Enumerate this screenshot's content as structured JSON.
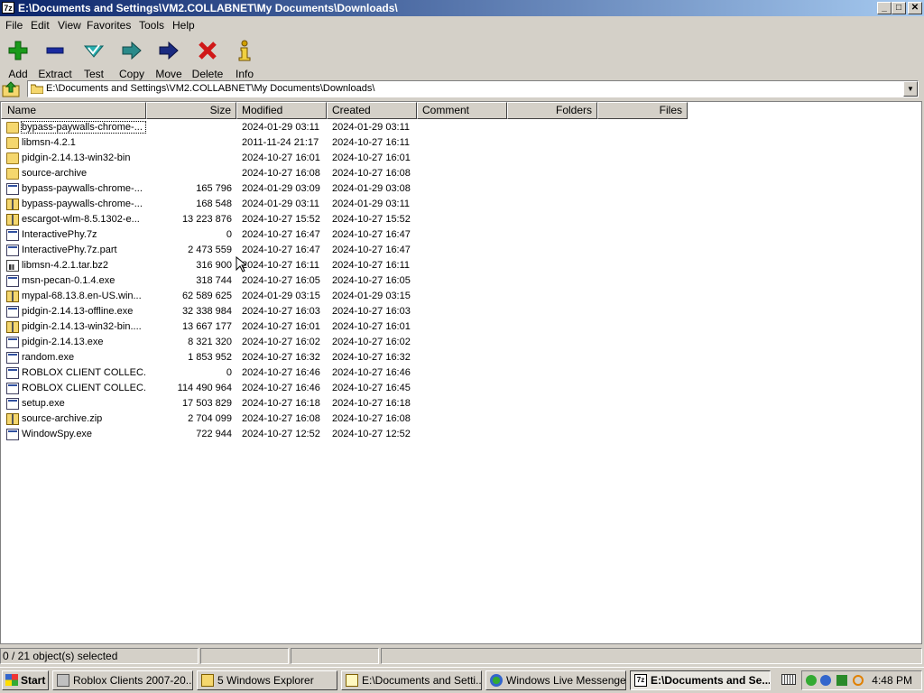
{
  "window": {
    "title_icon": "7z",
    "title": "E:\\Documents and Settings\\VM2.COLLABNET\\My Documents\\Downloads\\",
    "controls": {
      "minimize": "_",
      "maximize": "□",
      "close": "✕"
    }
  },
  "menu": [
    "File",
    "Edit",
    "View",
    "Favorites",
    "Tools",
    "Help"
  ],
  "toolbar": [
    {
      "label": "Add",
      "icon": "plus-icon",
      "color": "#1a9a1a"
    },
    {
      "label": "Extract",
      "icon": "minus-icon",
      "color": "#1a2aa0"
    },
    {
      "label": "Test",
      "icon": "check-icon",
      "color": "#2aa0a0"
    },
    {
      "label": "Copy",
      "icon": "copy-arrow-icon",
      "color": "#2a8a8a"
    },
    {
      "label": "Move",
      "icon": "move-arrow-icon",
      "color": "#1a2a80"
    },
    {
      "label": "Delete",
      "icon": "delete-x-icon",
      "color": "#d01818"
    },
    {
      "label": "Info",
      "icon": "info-icon",
      "color": "#b08000"
    }
  ],
  "address": {
    "value": "E:\\Documents and Settings\\VM2.COLLABNET\\My Documents\\Downloads\\"
  },
  "columns": [
    "Name",
    "Size",
    "Modified",
    "Created",
    "Comment",
    "Folders",
    "Files"
  ],
  "files": [
    {
      "name": "bypass-paywalls-chrome-...",
      "size": "",
      "modified": "2024-01-29 03:11",
      "created": "2024-01-29 03:11",
      "type": "folder"
    },
    {
      "name": "libmsn-4.2.1",
      "size": "",
      "modified": "2011-11-24 21:17",
      "created": "2024-10-27 16:11",
      "type": "folder"
    },
    {
      "name": "pidgin-2.14.13-win32-bin",
      "size": "",
      "modified": "2024-10-27 16:01",
      "created": "2024-10-27 16:01",
      "type": "folder"
    },
    {
      "name": "source-archive",
      "size": "",
      "modified": "2024-10-27 16:08",
      "created": "2024-10-27 16:08",
      "type": "folder"
    },
    {
      "name": "bypass-paywalls-chrome-...",
      "size": "165 796",
      "modified": "2024-01-29 03:09",
      "created": "2024-01-29 03:08",
      "type": "file"
    },
    {
      "name": "bypass-paywalls-chrome-...",
      "size": "168 548",
      "modified": "2024-01-29 03:11",
      "created": "2024-01-29 03:11",
      "type": "zip"
    },
    {
      "name": "escargot-wlm-8.5.1302-e...",
      "size": "13 223 876",
      "modified": "2024-10-27 15:52",
      "created": "2024-10-27 15:52",
      "type": "zip"
    },
    {
      "name": "InteractivePhy.7z",
      "size": "0",
      "modified": "2024-10-27 16:47",
      "created": "2024-10-27 16:47",
      "type": "file"
    },
    {
      "name": "InteractivePhy.7z.part",
      "size": "2 473 559",
      "modified": "2024-10-27 16:47",
      "created": "2024-10-27 16:47",
      "type": "file"
    },
    {
      "name": "libmsn-4.2.1.tar.bz2",
      "size": "316 900",
      "modified": "2024-10-27 16:11",
      "created": "2024-10-27 16:11",
      "type": "img"
    },
    {
      "name": "msn-pecan-0.1.4.exe",
      "size": "318 744",
      "modified": "2024-10-27 16:05",
      "created": "2024-10-27 16:05",
      "type": "file"
    },
    {
      "name": "mypal-68.13.8.en-US.win...",
      "size": "62 589 625",
      "modified": "2024-01-29 03:15",
      "created": "2024-01-29 03:15",
      "type": "zip"
    },
    {
      "name": "pidgin-2.14.13-offline.exe",
      "size": "32 338 984",
      "modified": "2024-10-27 16:03",
      "created": "2024-10-27 16:03",
      "type": "file"
    },
    {
      "name": "pidgin-2.14.13-win32-bin....",
      "size": "13 667 177",
      "modified": "2024-10-27 16:01",
      "created": "2024-10-27 16:01",
      "type": "zip"
    },
    {
      "name": "pidgin-2.14.13.exe",
      "size": "8 321 320",
      "modified": "2024-10-27 16:02",
      "created": "2024-10-27 16:02",
      "type": "file"
    },
    {
      "name": "random.exe",
      "size": "1 853 952",
      "modified": "2024-10-27 16:32",
      "created": "2024-10-27 16:32",
      "type": "file"
    },
    {
      "name": "ROBLOX CLIENT COLLEC...",
      "size": "0",
      "modified": "2024-10-27 16:46",
      "created": "2024-10-27 16:46",
      "type": "file"
    },
    {
      "name": "ROBLOX CLIENT COLLEC...",
      "size": "114 490 964",
      "modified": "2024-10-27 16:46",
      "created": "2024-10-27 16:45",
      "type": "file"
    },
    {
      "name": "setup.exe",
      "size": "17 503 829",
      "modified": "2024-10-27 16:18",
      "created": "2024-10-27 16:18",
      "type": "file"
    },
    {
      "name": "source-archive.zip",
      "size": "2 704 099",
      "modified": "2024-10-27 16:08",
      "created": "2024-10-27 16:08",
      "type": "zip"
    },
    {
      "name": "WindowSpy.exe",
      "size": "722 944",
      "modified": "2024-10-27 12:52",
      "created": "2024-10-27 12:52",
      "type": "file"
    }
  ],
  "status": {
    "selection": "0 / 21 object(s) selected"
  },
  "taskbar": {
    "start": "Start",
    "tasks": [
      {
        "label": "Roblox Clients 2007-20...",
        "icon": "roblox-icon"
      },
      {
        "label": "5 Windows Explorer",
        "icon": "folder-icon"
      },
      {
        "label": "E:\\Documents and Setti...",
        "icon": "notepad-icon"
      },
      {
        "label": "Windows Live Messenger",
        "icon": "messenger-icon"
      },
      {
        "label": "E:\\Documents and Se...",
        "icon": "7zip-icon"
      }
    ],
    "clock": "4:48 PM"
  }
}
